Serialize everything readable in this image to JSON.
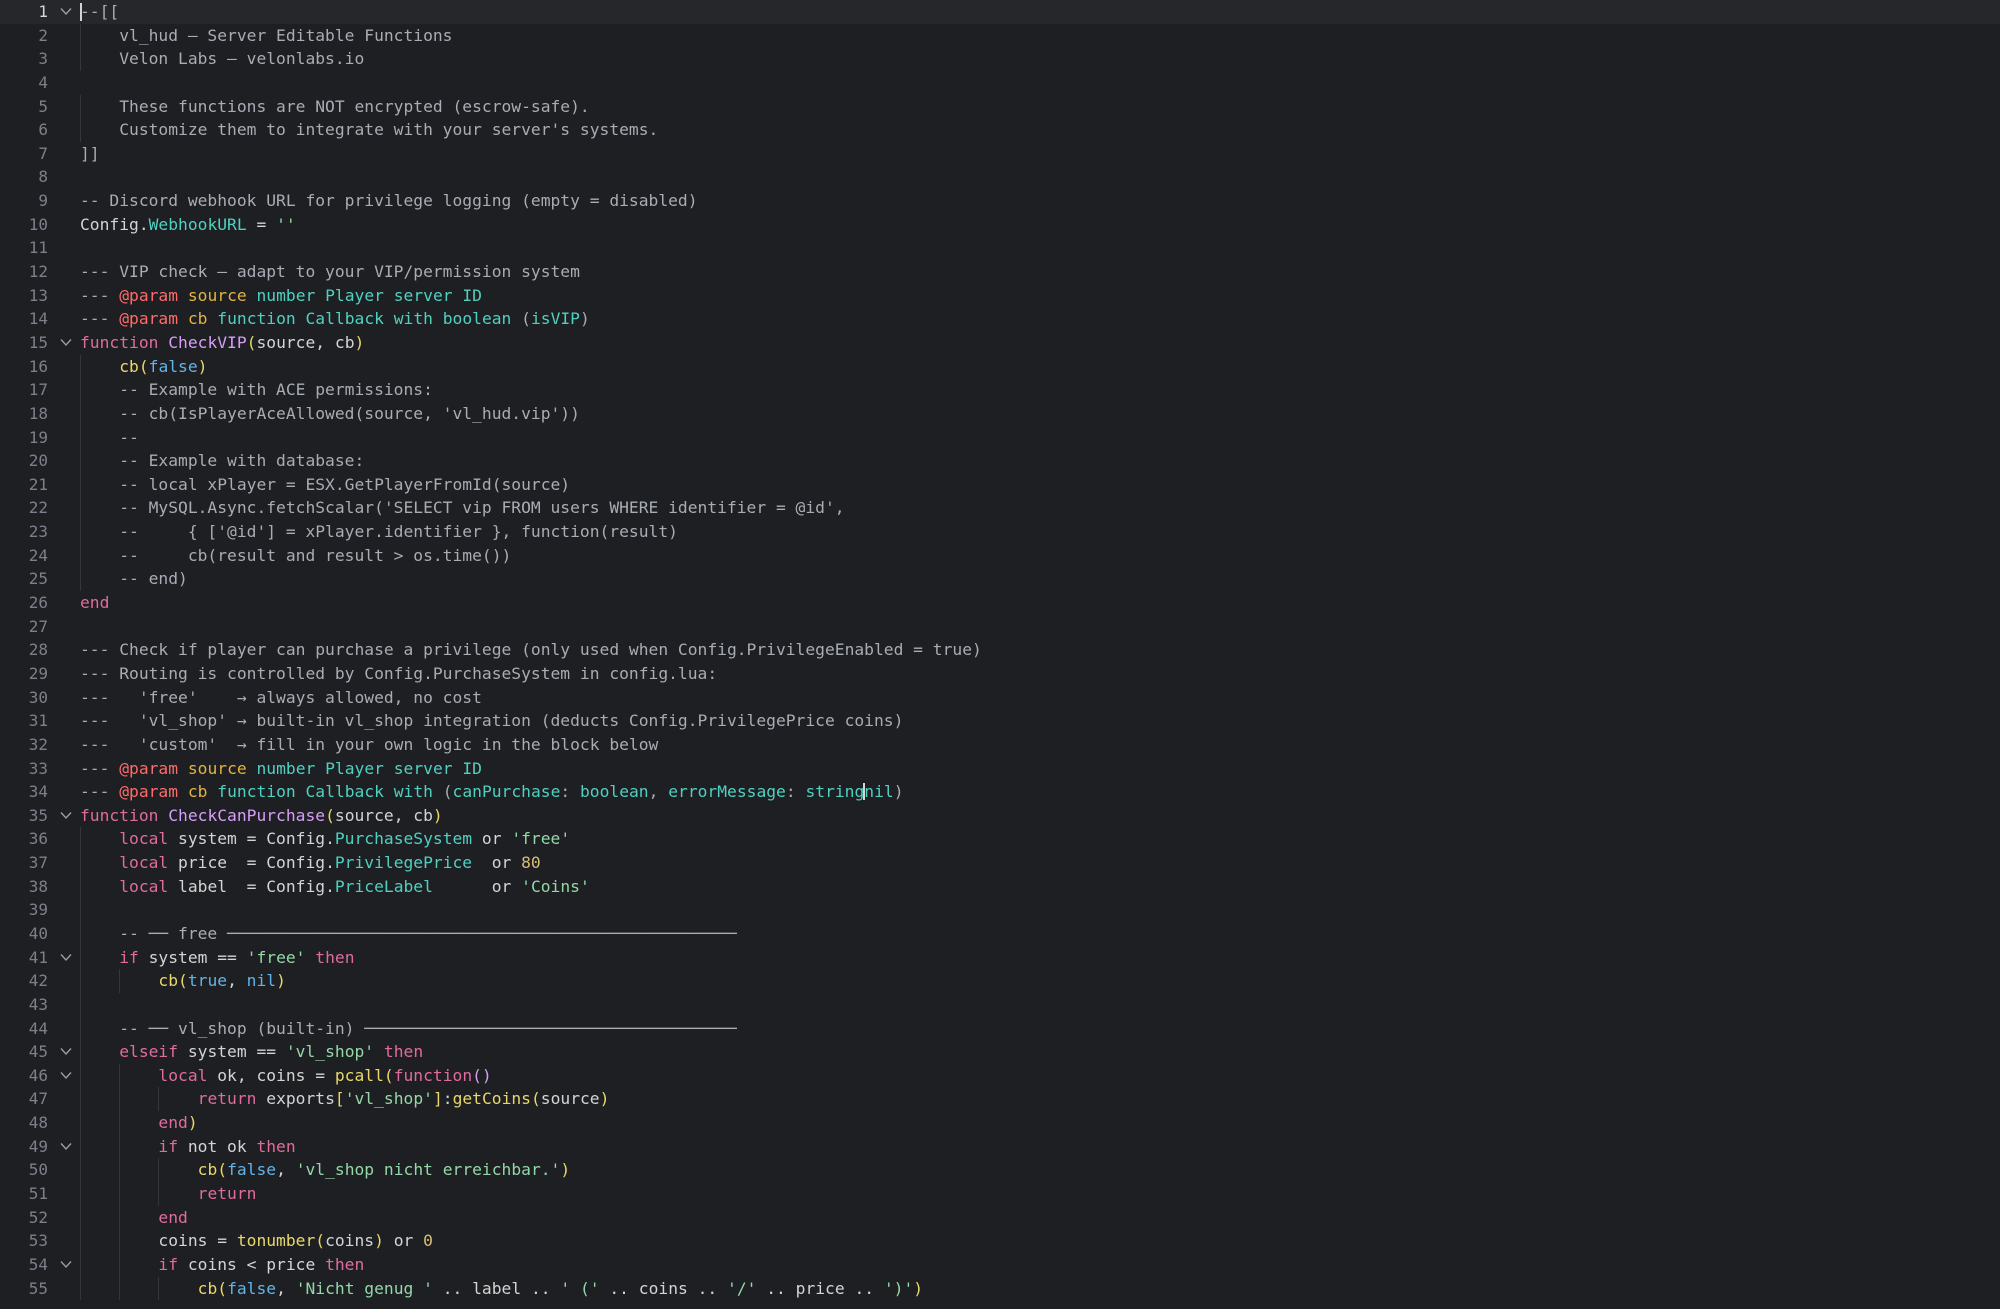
{
  "editor": {
    "active_line": 1,
    "lines": [
      {
        "n": "1",
        "indent": 0,
        "fold": true,
        "t": [
          [
            "c",
            "--[["
          ]
        ]
      },
      {
        "n": "2",
        "indent": 1,
        "fold": false,
        "t": [
          [
            "c",
            "    vl_hud — Server Editable Functions"
          ]
        ]
      },
      {
        "n": "3",
        "indent": 1,
        "fold": false,
        "t": [
          [
            "c",
            "    Velon Labs — velonlabs.io"
          ]
        ]
      },
      {
        "n": "4",
        "indent": 0,
        "fold": false,
        "t": []
      },
      {
        "n": "5",
        "indent": 1,
        "fold": false,
        "t": [
          [
            "c",
            "    These functions are NOT encrypted (escrow-safe)."
          ]
        ]
      },
      {
        "n": "6",
        "indent": 1,
        "fold": false,
        "t": [
          [
            "c",
            "    Customize them to integrate with your server's systems."
          ]
        ]
      },
      {
        "n": "7",
        "indent": 0,
        "fold": false,
        "t": [
          [
            "c",
            "]]"
          ]
        ]
      },
      {
        "n": "8",
        "indent": 0,
        "fold": false,
        "t": []
      },
      {
        "n": "9",
        "indent": 0,
        "fold": false,
        "t": [
          [
            "c",
            "-- Discord webhook URL for privilege logging (empty = disabled)"
          ]
        ]
      },
      {
        "n": "10",
        "indent": 0,
        "fold": false,
        "t": [
          [
            "id",
            "Config."
          ],
          [
            "prop",
            "WebhookURL"
          ],
          [
            "id",
            " = "
          ],
          [
            "str",
            "''"
          ]
        ]
      },
      {
        "n": "11",
        "indent": 0,
        "fold": false,
        "t": []
      },
      {
        "n": "12",
        "indent": 0,
        "fold": false,
        "t": [
          [
            "c",
            "--- VIP check — adapt to your VIP/permission system"
          ]
        ]
      },
      {
        "n": "13",
        "indent": 0,
        "fold": false,
        "t": [
          [
            "c",
            "--- "
          ],
          [
            "tag",
            "@param"
          ],
          [
            "c",
            " "
          ],
          [
            "par",
            "source"
          ],
          [
            "c",
            " "
          ],
          [
            "ty",
            "number Player server ID"
          ]
        ]
      },
      {
        "n": "14",
        "indent": 0,
        "fold": false,
        "t": [
          [
            "c",
            "--- "
          ],
          [
            "tag",
            "@param"
          ],
          [
            "c",
            " "
          ],
          [
            "par",
            "cb"
          ],
          [
            "c",
            " "
          ],
          [
            "ty",
            "function Callback with boolean"
          ],
          [
            "c",
            " ("
          ],
          [
            "ty",
            "isVIP"
          ],
          [
            "c",
            ")"
          ]
        ]
      },
      {
        "n": "15",
        "indent": 0,
        "fold": true,
        "t": [
          [
            "kw",
            "function"
          ],
          [
            "id",
            " "
          ],
          [
            "fn",
            "CheckVIP"
          ],
          [
            "fc",
            "("
          ],
          [
            "id",
            "source, cb"
          ],
          [
            "fc",
            ")"
          ]
        ]
      },
      {
        "n": "16",
        "indent": 1,
        "fold": false,
        "t": [
          [
            "id",
            "    "
          ],
          [
            "fc",
            "cb("
          ],
          [
            "bool",
            "false"
          ],
          [
            "fc",
            ")"
          ]
        ]
      },
      {
        "n": "17",
        "indent": 1,
        "fold": false,
        "t": [
          [
            "c",
            "    -- Example with ACE permissions:"
          ]
        ]
      },
      {
        "n": "18",
        "indent": 1,
        "fold": false,
        "t": [
          [
            "c",
            "    -- cb(IsPlayerAceAllowed(source, 'vl_hud.vip'))"
          ]
        ]
      },
      {
        "n": "19",
        "indent": 1,
        "fold": false,
        "t": [
          [
            "c",
            "    --"
          ]
        ]
      },
      {
        "n": "20",
        "indent": 1,
        "fold": false,
        "t": [
          [
            "c",
            "    -- Example with database:"
          ]
        ]
      },
      {
        "n": "21",
        "indent": 1,
        "fold": false,
        "t": [
          [
            "c",
            "    -- local xPlayer = ESX.GetPlayerFromId(source)"
          ]
        ]
      },
      {
        "n": "22",
        "indent": 1,
        "fold": false,
        "t": [
          [
            "c",
            "    -- MySQL.Async.fetchScalar('SELECT vip FROM users WHERE identifier = @id',"
          ]
        ]
      },
      {
        "n": "23",
        "indent": 1,
        "fold": false,
        "t": [
          [
            "c",
            "    --     { ['@id'] = xPlayer.identifier }, function(result)"
          ]
        ]
      },
      {
        "n": "24",
        "indent": 1,
        "fold": false,
        "t": [
          [
            "c",
            "    --     cb(result and result > os.time())"
          ]
        ]
      },
      {
        "n": "25",
        "indent": 1,
        "fold": false,
        "t": [
          [
            "c",
            "    -- end)"
          ]
        ]
      },
      {
        "n": "26",
        "indent": 0,
        "fold": false,
        "t": [
          [
            "kw",
            "end"
          ]
        ]
      },
      {
        "n": "27",
        "indent": 0,
        "fold": false,
        "t": []
      },
      {
        "n": "28",
        "indent": 0,
        "fold": false,
        "t": [
          [
            "c",
            "--- Check if player can purchase a privilege (only used when Config.PrivilegeEnabled = true)"
          ]
        ]
      },
      {
        "n": "29",
        "indent": 0,
        "fold": false,
        "t": [
          [
            "c",
            "--- Routing is controlled by Config.PurchaseSystem in config.lua:"
          ]
        ]
      },
      {
        "n": "30",
        "indent": 0,
        "fold": false,
        "t": [
          [
            "c",
            "---   'free'    → always allowed, no cost"
          ]
        ]
      },
      {
        "n": "31",
        "indent": 0,
        "fold": false,
        "t": [
          [
            "c",
            "---   'vl_shop' → built-in vl_shop integration (deducts Config.PrivilegePrice coins)"
          ]
        ]
      },
      {
        "n": "32",
        "indent": 0,
        "fold": false,
        "t": [
          [
            "c",
            "---   'custom'  → fill in your own logic in the block below"
          ]
        ]
      },
      {
        "n": "33",
        "indent": 0,
        "fold": false,
        "t": [
          [
            "c",
            "--- "
          ],
          [
            "tag",
            "@param"
          ],
          [
            "c",
            " "
          ],
          [
            "par",
            "source"
          ],
          [
            "c",
            " "
          ],
          [
            "ty",
            "number Player server ID"
          ]
        ]
      },
      {
        "n": "34",
        "indent": 0,
        "fold": false,
        "t": [
          [
            "c",
            "--- "
          ],
          [
            "tag",
            "@param"
          ],
          [
            "c",
            " "
          ],
          [
            "par",
            "cb"
          ],
          [
            "c",
            " "
          ],
          [
            "ty",
            "function Callback with"
          ],
          [
            "c",
            " ("
          ],
          [
            "ty",
            "canPurchase"
          ],
          [
            "c",
            ": "
          ],
          [
            "ty",
            "boolean"
          ],
          [
            "c",
            ", "
          ],
          [
            "ty",
            "errorMessage"
          ],
          [
            "c",
            ": "
          ],
          [
            "ty",
            "string"
          ],
          [
            "cur",
            ""
          ],
          [
            "ty",
            "nil"
          ],
          [
            "c",
            ")"
          ]
        ]
      },
      {
        "n": "35",
        "indent": 0,
        "fold": true,
        "t": [
          [
            "kw",
            "function"
          ],
          [
            "id",
            " "
          ],
          [
            "fn",
            "CheckCanPurchase"
          ],
          [
            "fc",
            "("
          ],
          [
            "id",
            "source, cb"
          ],
          [
            "fc",
            ")"
          ]
        ]
      },
      {
        "n": "36",
        "indent": 1,
        "fold": false,
        "t": [
          [
            "id",
            "    "
          ],
          [
            "kw",
            "local"
          ],
          [
            "id",
            " system = Config."
          ],
          [
            "prop",
            "PurchaseSystem"
          ],
          [
            "id",
            " or "
          ],
          [
            "str",
            "'free'"
          ]
        ]
      },
      {
        "n": "37",
        "indent": 1,
        "fold": false,
        "t": [
          [
            "id",
            "    "
          ],
          [
            "kw",
            "local"
          ],
          [
            "id",
            " price  = Config."
          ],
          [
            "prop",
            "PrivilegePrice"
          ],
          [
            "id",
            "  or "
          ],
          [
            "num",
            "80"
          ]
        ]
      },
      {
        "n": "38",
        "indent": 1,
        "fold": false,
        "t": [
          [
            "id",
            "    "
          ],
          [
            "kw",
            "local"
          ],
          [
            "id",
            " label  = Config."
          ],
          [
            "prop",
            "PriceLabel"
          ],
          [
            "id",
            "      or "
          ],
          [
            "str",
            "'Coins'"
          ]
        ]
      },
      {
        "n": "39",
        "indent": 1,
        "fold": false,
        "t": []
      },
      {
        "n": "40",
        "indent": 1,
        "fold": false,
        "t": [
          [
            "c",
            "    -- ── free ────────────────────────────────────────────────────"
          ]
        ]
      },
      {
        "n": "41",
        "indent": 1,
        "fold": true,
        "t": [
          [
            "id",
            "    "
          ],
          [
            "kw",
            "if"
          ],
          [
            "id",
            " system == "
          ],
          [
            "str",
            "'free'"
          ],
          [
            "id",
            " "
          ],
          [
            "kw",
            "then"
          ]
        ]
      },
      {
        "n": "42",
        "indent": 2,
        "fold": false,
        "t": [
          [
            "id",
            "        "
          ],
          [
            "fc",
            "cb("
          ],
          [
            "bool",
            "true"
          ],
          [
            "id",
            ", "
          ],
          [
            "bool",
            "nil"
          ],
          [
            "fc",
            ")"
          ]
        ]
      },
      {
        "n": "43",
        "indent": 1,
        "fold": false,
        "t": []
      },
      {
        "n": "44",
        "indent": 1,
        "fold": false,
        "t": [
          [
            "c",
            "    -- ── vl_shop (built-in) ──────────────────────────────────────"
          ]
        ]
      },
      {
        "n": "45",
        "indent": 1,
        "fold": true,
        "t": [
          [
            "id",
            "    "
          ],
          [
            "kw",
            "elseif"
          ],
          [
            "id",
            " system == "
          ],
          [
            "str",
            "'vl_shop'"
          ],
          [
            "id",
            " "
          ],
          [
            "kw",
            "then"
          ]
        ]
      },
      {
        "n": "46",
        "indent": 2,
        "fold": true,
        "t": [
          [
            "id",
            "        "
          ],
          [
            "kw",
            "local"
          ],
          [
            "id",
            " ok, coins = "
          ],
          [
            "fc",
            "pcall("
          ],
          [
            "kw",
            "function"
          ],
          [
            "fn",
            "()"
          ]
        ]
      },
      {
        "n": "47",
        "indent": 3,
        "fold": false,
        "t": [
          [
            "id",
            "            "
          ],
          [
            "kw",
            "return"
          ],
          [
            "id",
            " exports"
          ],
          [
            "fc",
            "["
          ],
          [
            "str",
            "'vl_shop'"
          ],
          [
            "fc",
            "]"
          ],
          [
            "id",
            ":"
          ],
          [
            "fc",
            "getCoins("
          ],
          [
            "id",
            "source"
          ],
          [
            "fc",
            ")"
          ]
        ]
      },
      {
        "n": "48",
        "indent": 2,
        "fold": false,
        "t": [
          [
            "id",
            "        "
          ],
          [
            "kw",
            "end"
          ],
          [
            "fc",
            ")"
          ]
        ]
      },
      {
        "n": "49",
        "indent": 2,
        "fold": true,
        "t": [
          [
            "id",
            "        "
          ],
          [
            "kw",
            "if"
          ],
          [
            "id",
            " not ok "
          ],
          [
            "kw",
            "then"
          ]
        ]
      },
      {
        "n": "50",
        "indent": 3,
        "fold": false,
        "t": [
          [
            "id",
            "            "
          ],
          [
            "fc",
            "cb("
          ],
          [
            "bool",
            "false"
          ],
          [
            "id",
            ", "
          ],
          [
            "str",
            "'vl_shop nicht erreichbar.'"
          ],
          [
            "fc",
            ")"
          ]
        ]
      },
      {
        "n": "51",
        "indent": 3,
        "fold": false,
        "t": [
          [
            "id",
            "            "
          ],
          [
            "kw",
            "return"
          ]
        ]
      },
      {
        "n": "52",
        "indent": 2,
        "fold": false,
        "t": [
          [
            "id",
            "        "
          ],
          [
            "kw",
            "end"
          ]
        ]
      },
      {
        "n": "53",
        "indent": 2,
        "fold": false,
        "t": [
          [
            "id",
            "        coins = "
          ],
          [
            "fc",
            "tonumber("
          ],
          [
            "id",
            "coins"
          ],
          [
            "fc",
            ")"
          ],
          [
            "id",
            " or "
          ],
          [
            "num",
            "0"
          ]
        ]
      },
      {
        "n": "54",
        "indent": 2,
        "fold": true,
        "t": [
          [
            "id",
            "        "
          ],
          [
            "kw",
            "if"
          ],
          [
            "id",
            " coins < price "
          ],
          [
            "kw",
            "then"
          ]
        ]
      },
      {
        "n": "55",
        "indent": 3,
        "fold": false,
        "t": [
          [
            "id",
            "            "
          ],
          [
            "fc",
            "cb("
          ],
          [
            "bool",
            "false"
          ],
          [
            "id",
            ", "
          ],
          [
            "str",
            "'Nicht genug '"
          ],
          [
            "id",
            " .. label .. "
          ],
          [
            "str",
            "' ('"
          ],
          [
            "id",
            " .. coins .. "
          ],
          [
            "str",
            "'/'"
          ],
          [
            "id",
            " .. price .. "
          ],
          [
            "str",
            "')'"
          ],
          [
            "fc",
            ")"
          ]
        ]
      }
    ]
  }
}
